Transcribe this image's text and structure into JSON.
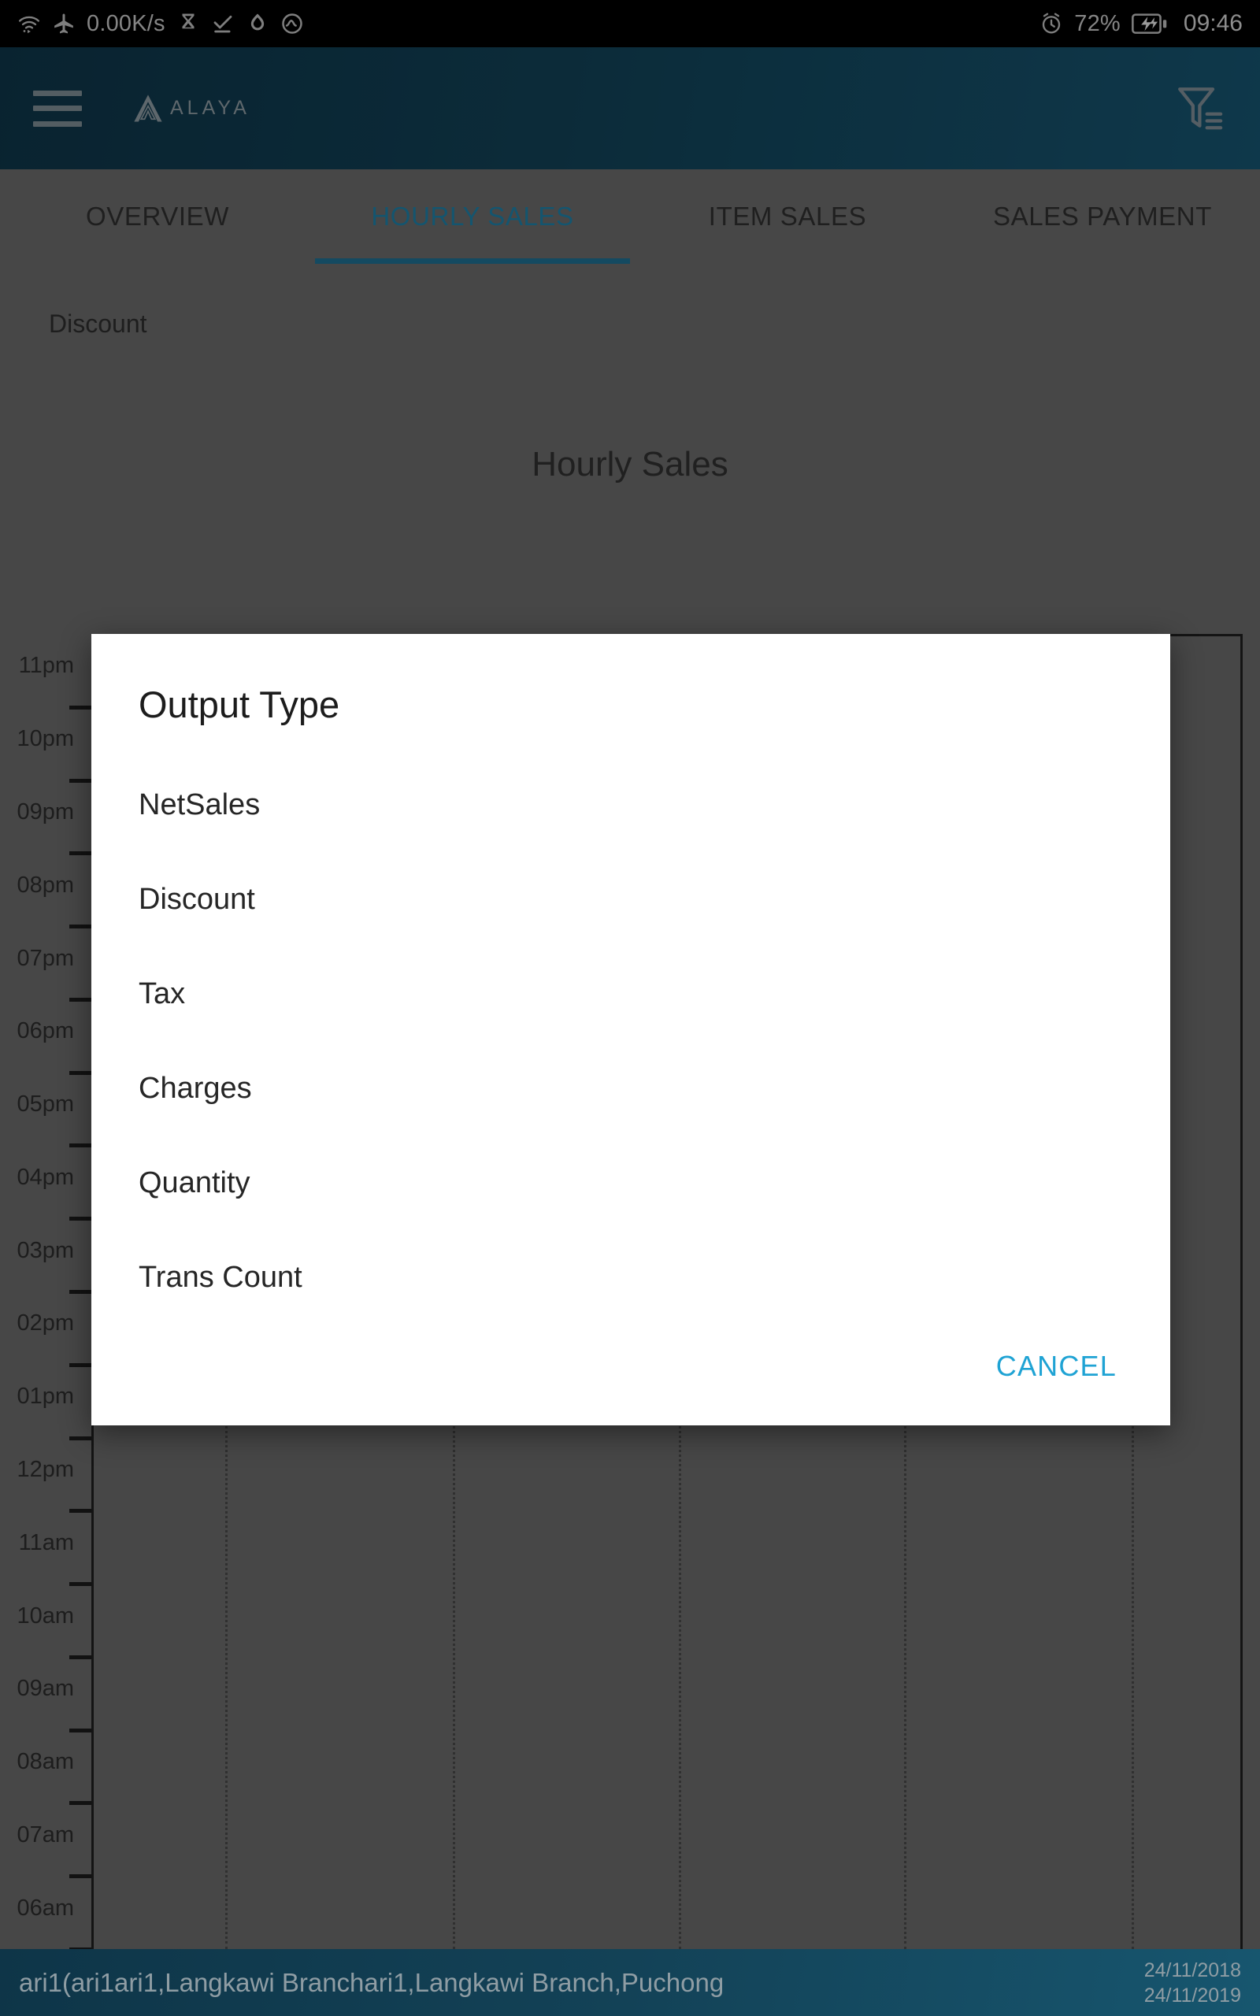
{
  "statusbar": {
    "network_speed": "0.00K/s",
    "battery_percent": "72%",
    "clock": "09:46",
    "icons": [
      "wifi-icon",
      "airplane-mode-icon",
      "hourglass-icon",
      "download-complete-icon",
      "sync-icon",
      "activity-icon",
      "alarm-icon",
      "battery-charging-icon"
    ]
  },
  "appbar": {
    "menu_icon": "hamburger-menu-icon",
    "brand": "ALAYA",
    "filter_icon": "filter-funnel-icon"
  },
  "tabs": [
    {
      "label": "OVERVIEW",
      "active": false
    },
    {
      "label": "HOURLY SALES",
      "active": true
    },
    {
      "label": "ITEM SALES",
      "active": false
    },
    {
      "label": "SALES PAYMENT",
      "active": false
    }
  ],
  "chart_panel": {
    "legend": "Discount",
    "title": "Hourly Sales"
  },
  "chart_data": {
    "type": "bar",
    "title": "Hourly Sales",
    "orientation": "horizontal",
    "xlabel": "",
    "ylabel": "",
    "grid": true,
    "legend": [
      "Discount"
    ],
    "legend_position": "top-left",
    "categories": [
      "11pm",
      "10pm",
      "09pm",
      "08pm",
      "07pm",
      "06pm",
      "05pm",
      "04pm",
      "03pm",
      "02pm",
      "01pm",
      "12pm",
      "11am",
      "10am",
      "09am",
      "08am",
      "07am",
      "06am"
    ],
    "values": [
      0,
      0,
      0,
      0,
      0,
      0,
      0,
      0,
      0,
      0,
      0,
      0,
      0,
      0,
      0,
      0,
      0,
      0
    ],
    "series": [
      {
        "name": "Discount",
        "values": [
          0,
          0,
          0,
          0,
          0,
          0,
          0,
          0,
          0,
          0,
          0,
          0,
          0,
          0,
          0,
          0,
          0,
          0
        ]
      }
    ]
  },
  "dialog": {
    "title": "Output Type",
    "options": [
      "NetSales",
      "Discount",
      "Tax",
      "Charges",
      "Quantity",
      "Trans Count"
    ],
    "cancel_label": "CANCEL"
  },
  "bottombar": {
    "filter_summary": "ari1(ari1ari1,Langkawi Branchari1,Langkawi Branch,Puchong",
    "date_from": "24/11/2018",
    "date_to": "24/11/2019"
  },
  "colors": {
    "appbar_start": "#0e3548",
    "appbar_end": "#165470",
    "tab_active": "#1f7fa6",
    "dialog_action": "#1fa3d4",
    "page_bg": "#6a6a6a"
  }
}
